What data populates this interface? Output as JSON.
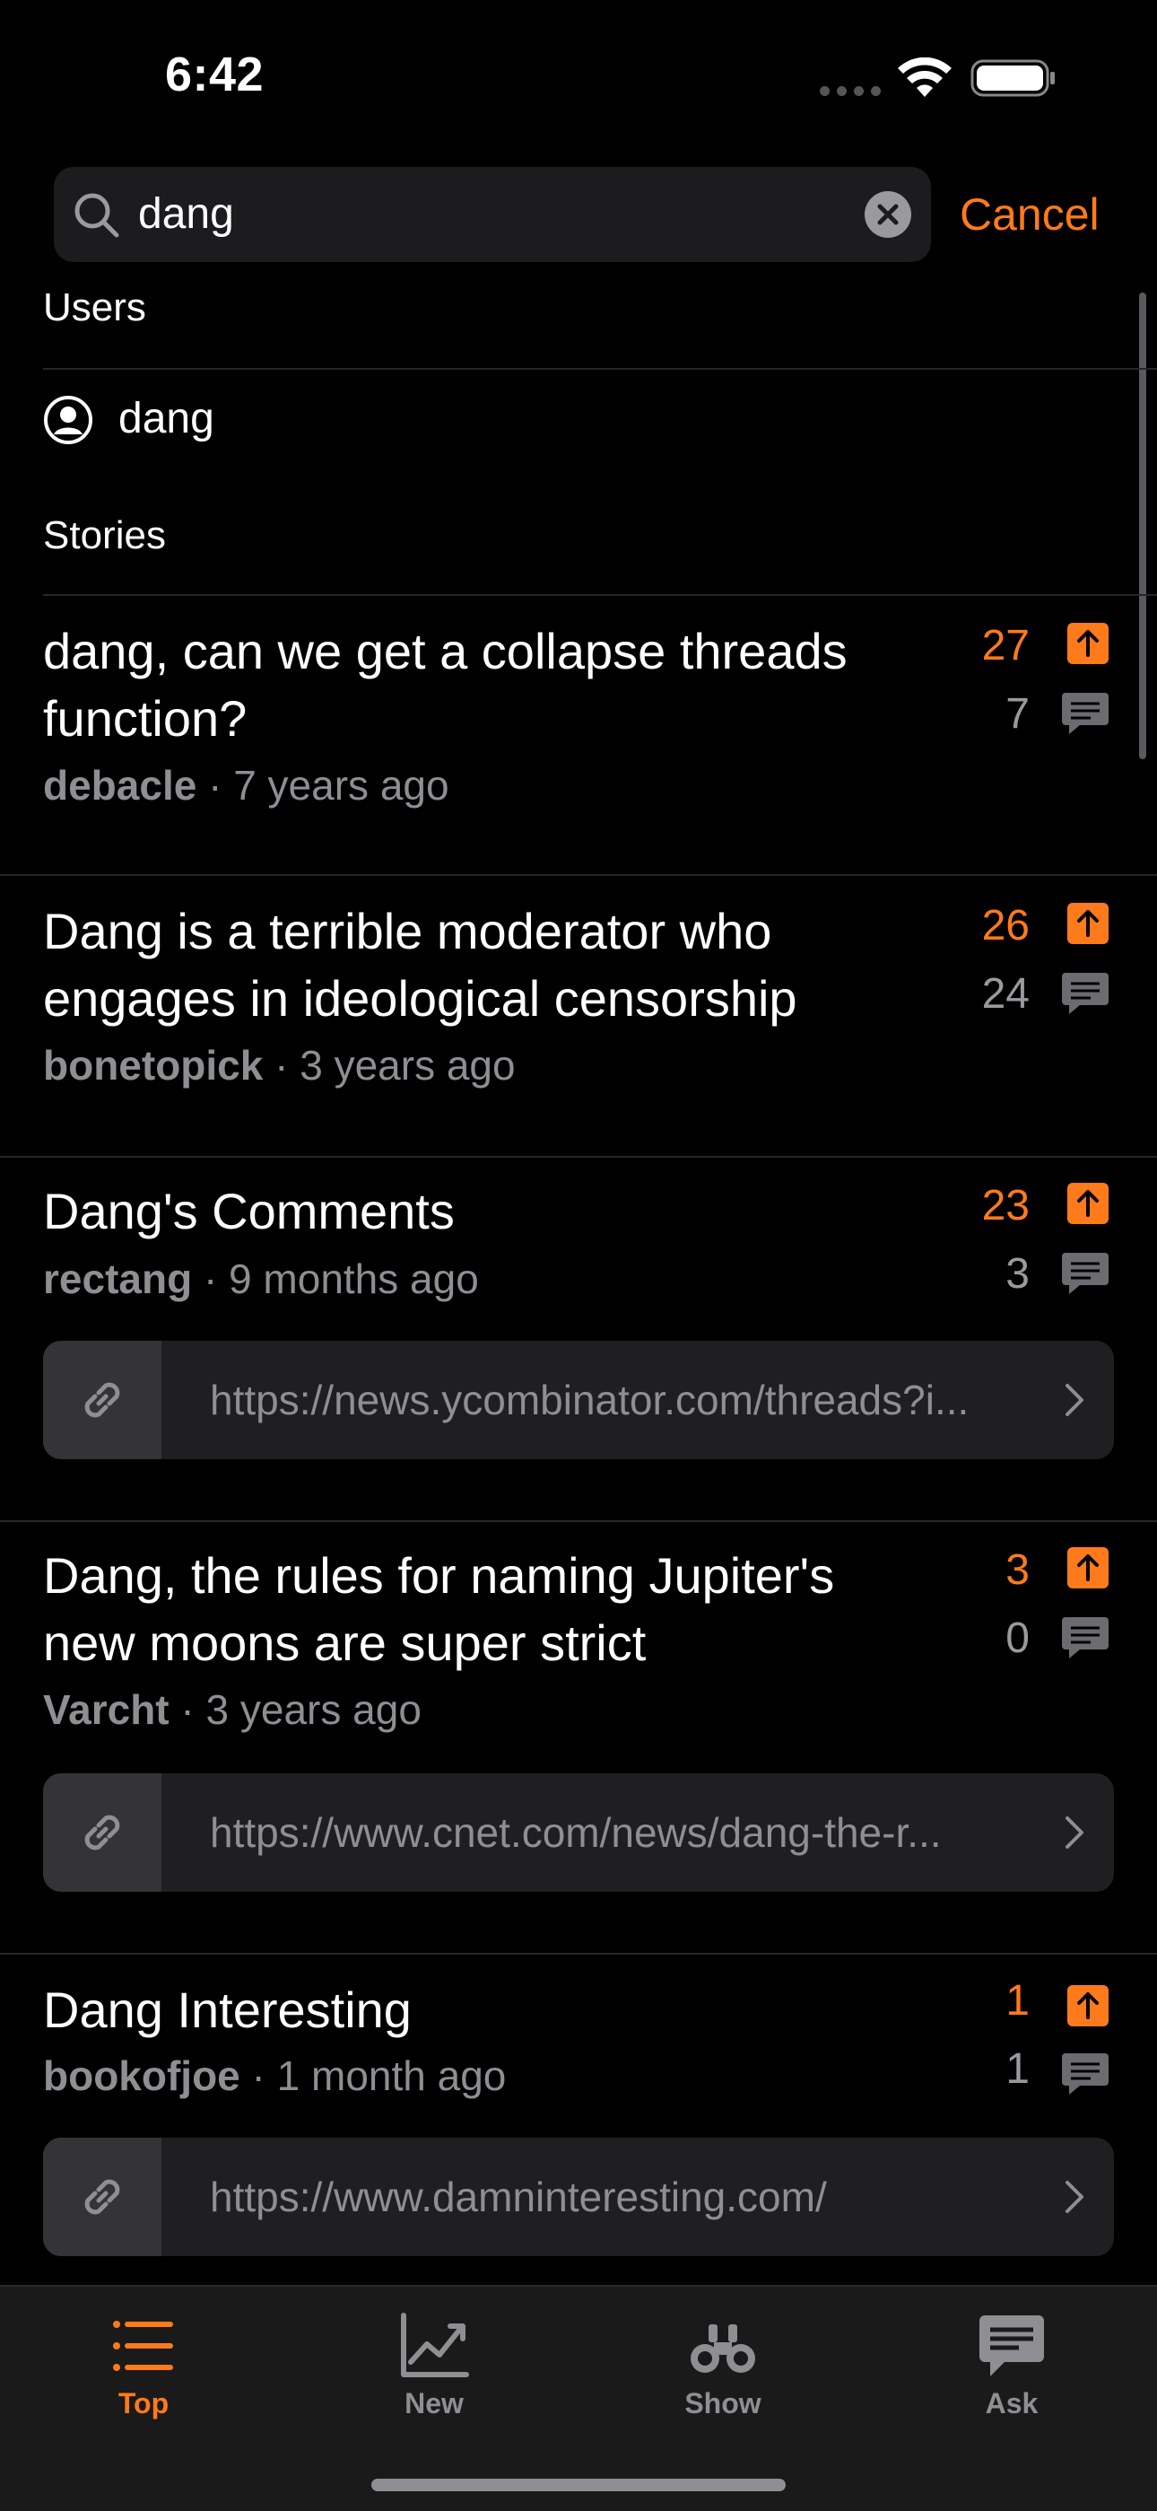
{
  "status_bar": {
    "time": "6:42"
  },
  "search": {
    "query": "dang",
    "cancel_label": "Cancel"
  },
  "sections": {
    "users_header": "Users",
    "stories_header": "Stories"
  },
  "users": [
    {
      "name": "dang"
    }
  ],
  "stories": [
    {
      "title": "dang, can we get a collapse threads function?",
      "author": "debacle",
      "age": " · 7 years ago",
      "score": "27",
      "comments": "7",
      "url": ""
    },
    {
      "title": "Dang is a terrible moderator who engages in ideological censorship",
      "author": "bonetopick",
      "age": " · 3 years ago",
      "score": "26",
      "comments": "24",
      "url": ""
    },
    {
      "title": "Dang's Comments",
      "author": "rectang",
      "age": " · 9 months ago",
      "score": "23",
      "comments": "3",
      "url": "https://news.ycombinator.com/threads?i..."
    },
    {
      "title": "Dang, the rules for naming Jupiter's new moons are super strict",
      "author": "Varcht",
      "age": " · 3 years ago",
      "score": "3",
      "comments": "0",
      "url": "https://www.cnet.com/news/dang-the-r..."
    },
    {
      "title": "Dang Interesting",
      "author": "bookofjoe",
      "age": " · 1 month ago",
      "score": "1",
      "comments": "1",
      "url": "https://www.damninteresting.com/"
    }
  ],
  "tab_bar": {
    "tabs": [
      {
        "label": "Top",
        "icon": "list-icon",
        "active": true
      },
      {
        "label": "New",
        "icon": "chart-icon",
        "active": false
      },
      {
        "label": "Show",
        "icon": "binoculars-icon",
        "active": false
      },
      {
        "label": "Ask",
        "icon": "message-icon",
        "active": false
      }
    ]
  },
  "colors": {
    "accent": "#ff7a1a",
    "background": "#000000",
    "secondary_text": "#8e8e93"
  }
}
